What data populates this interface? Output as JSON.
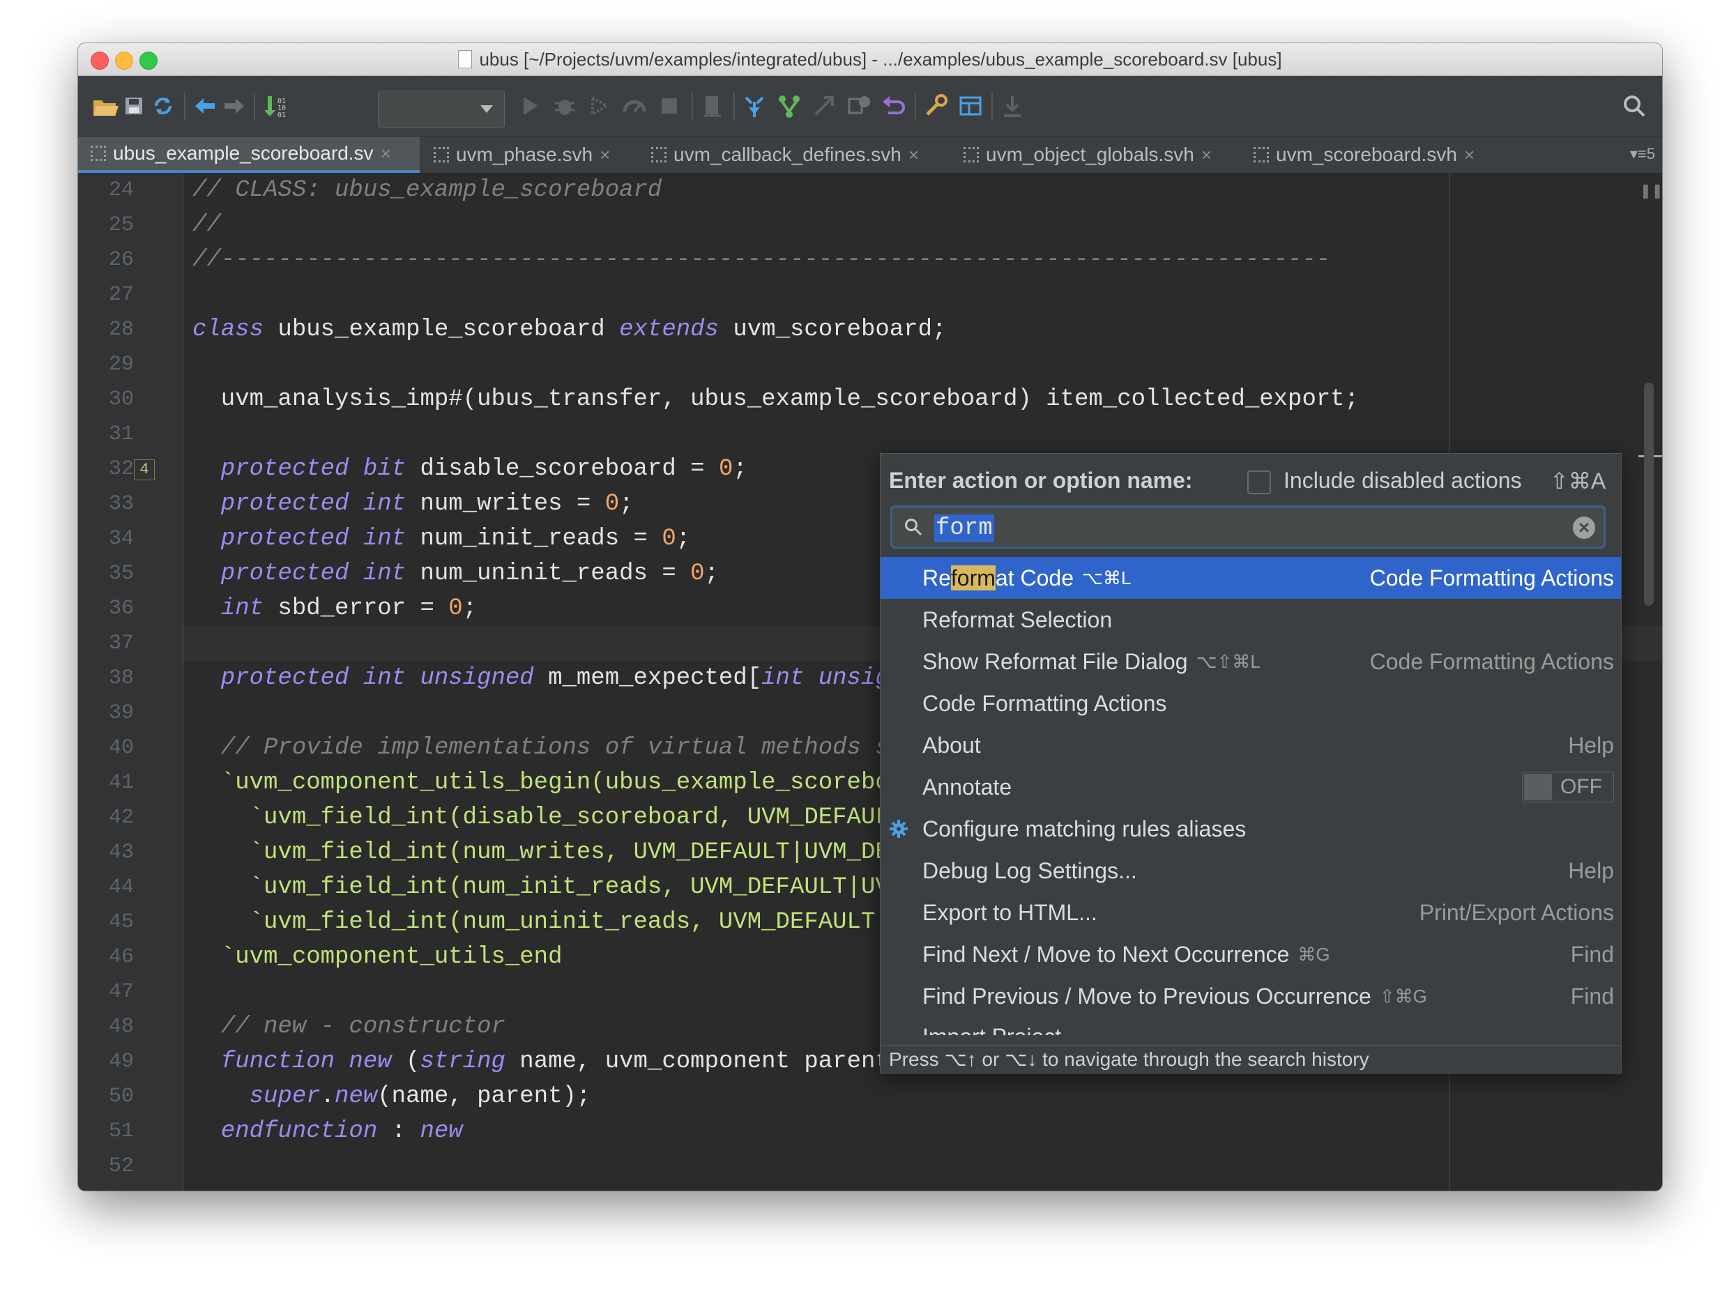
{
  "window": {
    "title": "ubus [~/Projects/uvm/examples/integrated/ubus] - .../examples/ubus_example_scoreboard.sv [ubus]"
  },
  "toolbar": {
    "icons": [
      "open-folder-icon",
      "save-icon",
      "sync-icon",
      "back-arrow-icon",
      "forward-arrow-icon",
      "build-icon",
      "run-icon",
      "debug-icon",
      "coverage-icon",
      "profile-icon",
      "stop-icon",
      "bookmark-icon",
      "vcs-update-icon",
      "vcs-commit-icon",
      "vcs-push-icon",
      "compare-icon",
      "revert-icon",
      "settings-icon",
      "structure-icon",
      "download-icon",
      "search-icon"
    ]
  },
  "tabs": [
    {
      "label": "ubus_example_scoreboard.sv",
      "active": true
    },
    {
      "label": "uvm_phase.svh",
      "active": false
    },
    {
      "label": "uvm_callback_defines.svh",
      "active": false
    },
    {
      "label": "uvm_object_globals.svh",
      "active": false
    },
    {
      "label": "uvm_scoreboard.svh",
      "active": false
    }
  ],
  "tabs_overflow": "5",
  "editor": {
    "line_numbers": [
      "24",
      "25",
      "26",
      "27",
      "28",
      "29",
      "30",
      "31",
      "32",
      "33",
      "34",
      "35",
      "36",
      "37",
      "38",
      "39",
      "40",
      "41",
      "42",
      "43",
      "44",
      "45",
      "46",
      "47",
      "48",
      "49",
      "50",
      "51",
      "52"
    ],
    "fold_badge": "4",
    "code": {
      "l24": "// CLASS: ubus_example_scoreboard",
      "l25": "//",
      "l26": "//------------------------------------------------------------------------------",
      "l28a": "class",
      "l28b": " ubus_example_scoreboard ",
      "l28c": "extends",
      "l28d": " uvm_scoreboard;",
      "l30": "  uvm_analysis_imp#(ubus_transfer, ubus_example_scoreboard) item_collected_export;",
      "l32a": "  protected bit",
      "l32b": " disable_scoreboard = ",
      "l32c": "0",
      "l32d": ";",
      "l33a": "  protected int",
      "l33b": " num_writes = ",
      "l33c": "0",
      "l33d": ";",
      "l34a": "  protected int",
      "l34b": " num_init_reads = ",
      "l34c": "0",
      "l34d": ";",
      "l35a": "  protected int",
      "l35b": " num_uninit_reads = ",
      "l35c": "0",
      "l35d": ";",
      "l36a": "  int",
      "l36b": " sbd_error = ",
      "l36c": "0",
      "l36d": ";",
      "l38a": "  protected int unsigned",
      "l38b": " m_mem_expected[",
      "l38c": "int unsigned",
      "l38d": "];",
      "l40": "  // Provide implementations of virtual methods such as get_type_name and create",
      "l41": "  `uvm_component_utils_begin(ubus_example_scoreboard)",
      "l42": "    `uvm_field_int(disable_scoreboard, UVM_DEFAULT)",
      "l43": "    `uvm_field_int(num_writes, UVM_DEFAULT|UVM_DEC)",
      "l44": "    `uvm_field_int(num_init_reads, UVM_DEFAULT|UVM_DEC)",
      "l45": "    `uvm_field_int(num_uninit_reads, UVM_DEFAULT|UVM_DEC)",
      "l46": "  `uvm_component_utils_end",
      "l48": "  // new - constructor",
      "l49a": "  function new",
      "l49b": " (",
      "l49c": "string",
      "l49d": " name, uvm_component parent);",
      "l50a": "    super",
      "l50b": ".",
      "l50c": "new",
      "l50d": "(name, parent);",
      "l51a": "  endfunction",
      "l51b": " : ",
      "l51c": "new"
    }
  },
  "popup": {
    "label": "Enter action or option name:",
    "include_disabled_label": "Include disabled actions",
    "include_disabled_shortcut": "⇧⌘A",
    "search_value": "form",
    "results": [
      {
        "pre": "Re",
        "hl": "form",
        "post": "at Code",
        "shortcut": "⌥⌘L",
        "category": "Code Formatting Actions"
      },
      {
        "name": "Reformat Selection"
      },
      {
        "name": "Show Reformat File Dialog",
        "shortcut": "⌥⇧⌘L",
        "category": "Code Formatting Actions"
      },
      {
        "name": "Code Formatting Actions"
      },
      {
        "name": "About",
        "category": "Help"
      },
      {
        "name": "Annotate",
        "toggle": "OFF"
      },
      {
        "name": "Configure matching rules aliases"
      },
      {
        "name": "Debug Log Settings...",
        "category": "Help"
      },
      {
        "name": "Export to HTML...",
        "category": "Print/Export Actions"
      },
      {
        "name": "Find Next / Move to Next Occurrence",
        "shortcut": "⌘G",
        "category": "Find"
      },
      {
        "name": "Find Previous / Move to Previous Occurrence",
        "shortcut": "⇧⌘G",
        "category": "Find"
      },
      {
        "name": "Import Project..."
      }
    ],
    "footer": "Press ⌥↑ or ⌥↓ to navigate through the search history"
  }
}
